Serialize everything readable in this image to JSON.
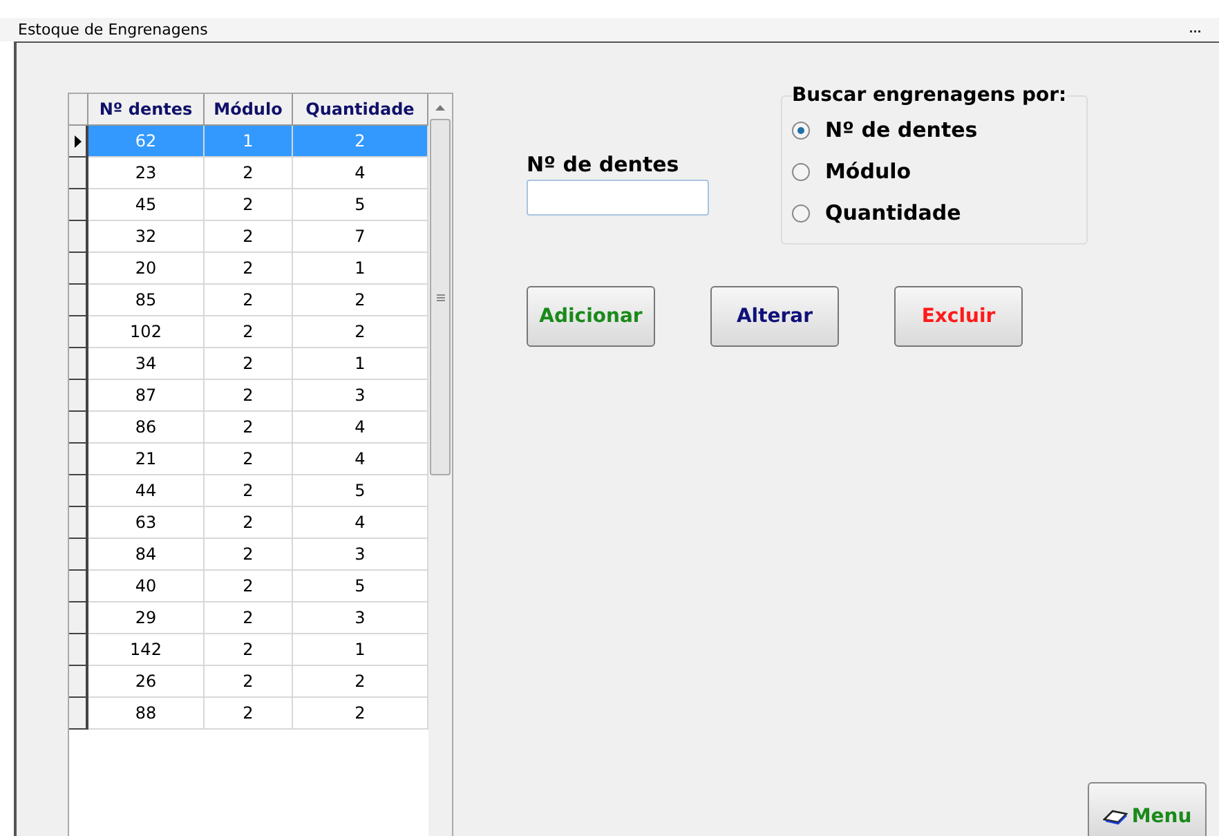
{
  "window": {
    "title": "Estoque de Engrenagens"
  },
  "table": {
    "columns": [
      "Nº dentes",
      "Módulo",
      "Quantidade"
    ],
    "rows": [
      {
        "cells": [
          "62",
          "1",
          "2"
        ],
        "selected": true
      },
      {
        "cells": [
          "23",
          "2",
          "4"
        ],
        "selected": false
      },
      {
        "cells": [
          "45",
          "2",
          "5"
        ],
        "selected": false
      },
      {
        "cells": [
          "32",
          "2",
          "7"
        ],
        "selected": false
      },
      {
        "cells": [
          "20",
          "2",
          "1"
        ],
        "selected": false
      },
      {
        "cells": [
          "85",
          "2",
          "2"
        ],
        "selected": false
      },
      {
        "cells": [
          "102",
          "2",
          "2"
        ],
        "selected": false
      },
      {
        "cells": [
          "34",
          "2",
          "1"
        ],
        "selected": false
      },
      {
        "cells": [
          "87",
          "2",
          "3"
        ],
        "selected": false
      },
      {
        "cells": [
          "86",
          "2",
          "4"
        ],
        "selected": false
      },
      {
        "cells": [
          "21",
          "2",
          "4"
        ],
        "selected": false
      },
      {
        "cells": [
          "44",
          "2",
          "5"
        ],
        "selected": false
      },
      {
        "cells": [
          "63",
          "2",
          "4"
        ],
        "selected": false
      },
      {
        "cells": [
          "84",
          "2",
          "3"
        ],
        "selected": false
      },
      {
        "cells": [
          "40",
          "2",
          "5"
        ],
        "selected": false
      },
      {
        "cells": [
          "29",
          "2",
          "3"
        ],
        "selected": false
      },
      {
        "cells": [
          "142",
          "2",
          "1"
        ],
        "selected": false
      },
      {
        "cells": [
          "26",
          "2",
          "2"
        ],
        "selected": false
      },
      {
        "cells": [
          "88",
          "2",
          "2"
        ],
        "selected": false
      }
    ]
  },
  "field": {
    "label": "Nº de dentes"
  },
  "search_group": {
    "title": "Buscar engrenagens por:",
    "options": [
      {
        "label": "Nº de dentes",
        "selected": true
      },
      {
        "label": "Módulo",
        "selected": false
      },
      {
        "label": "Quantidade",
        "selected": false
      }
    ]
  },
  "buttons": [
    {
      "label": "Adicionar",
      "color": "#1a8a1a"
    },
    {
      "label": "Alterar",
      "color": "#10107a"
    },
    {
      "label": "Excluir",
      "color": "#ff1a1a"
    }
  ],
  "menu_button": {
    "label": "Menu"
  }
}
